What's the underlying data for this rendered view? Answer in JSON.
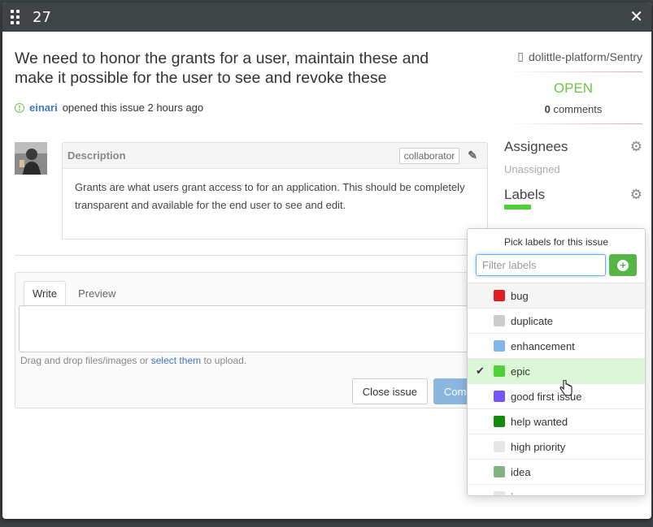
{
  "window": {
    "issue_number": "27"
  },
  "issue": {
    "title": "We need to honor the grants for a user, maintain these and make it possible for the user to see and revoke these",
    "author": "einari",
    "opened_text": "opened this issue 2 hours ago"
  },
  "description": {
    "label": "Description",
    "badge": "collaborator",
    "body": "Grants are what users grant access to for an application. This should be completely transparent and available for the end user to see and edit."
  },
  "compose": {
    "tab_write": "Write",
    "tab_preview": "Preview",
    "hint_prefix": "Drag and drop files/images or ",
    "hint_link": "select them",
    "hint_suffix": " to upload.",
    "close_label": "Close issue",
    "comment_label": "Comment"
  },
  "sidebar": {
    "repo": "dolittle-platform/Sentry",
    "state": "OPEN",
    "comments_count": "0",
    "comments_label": "comments",
    "assignees_title": "Assignees",
    "assignees_value": "Unassigned",
    "labels_title": "Labels"
  },
  "label_picker": {
    "title": "Pick labels for this issue",
    "filter_placeholder": "Filter labels",
    "labels": [
      {
        "name": "bug",
        "color": "#e11d21",
        "checked": false
      },
      {
        "name": "duplicate",
        "color": "#cccccc",
        "checked": false
      },
      {
        "name": "enhancement",
        "color": "#84b6eb",
        "checked": false
      },
      {
        "name": "epic",
        "color": "#4ed136",
        "checked": true
      },
      {
        "name": "good first issue",
        "color": "#7057ff",
        "checked": false
      },
      {
        "name": "help wanted",
        "color": "#128a0c",
        "checked": false
      },
      {
        "name": "high priority",
        "color": "#e6e6e6",
        "checked": false
      },
      {
        "name": "idea",
        "color": "#7fb27f",
        "checked": false
      },
      {
        "name": "i",
        "color": "#e6e6e6",
        "checked": false
      }
    ]
  }
}
